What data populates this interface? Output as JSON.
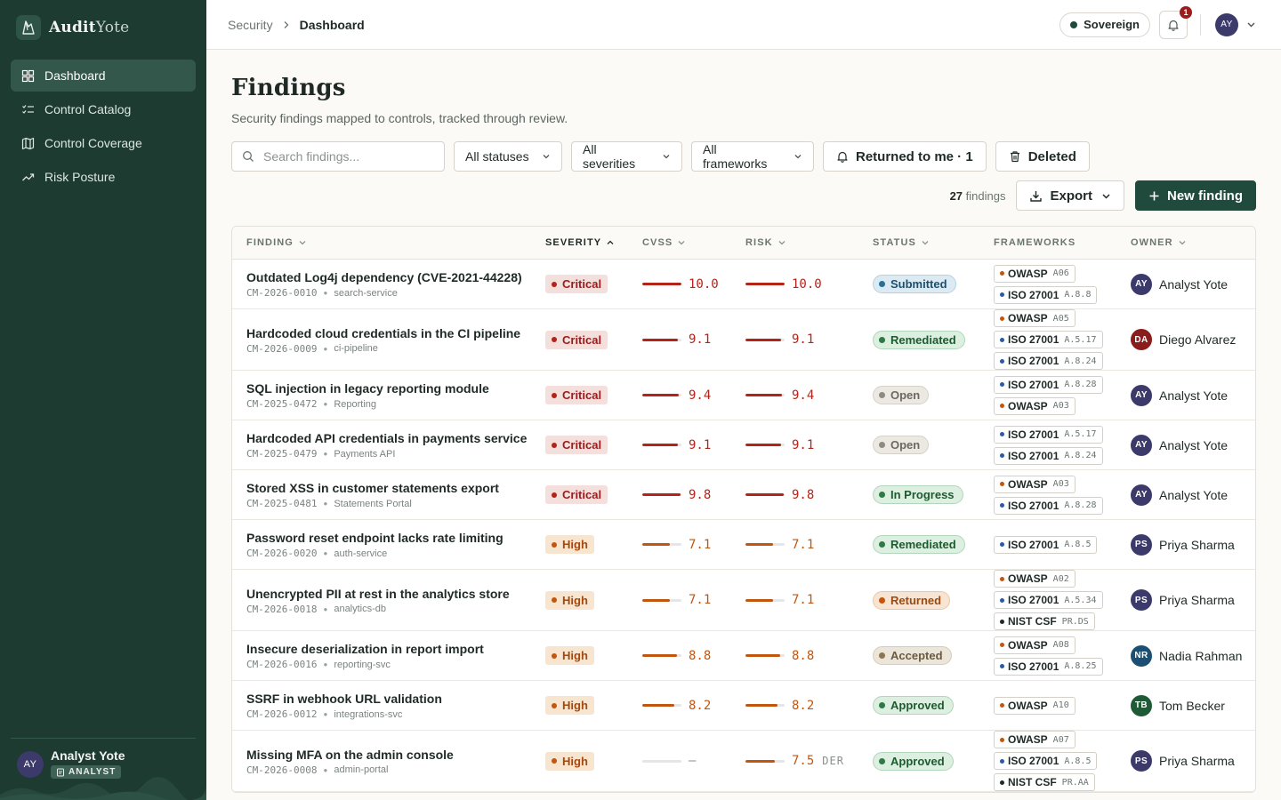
{
  "app": {
    "brand_bold": "Audit",
    "brand_thin": "Yote"
  },
  "sidebar": {
    "items": [
      {
        "label": "Dashboard",
        "icon": "dashboard-icon",
        "active": true
      },
      {
        "label": "Control Catalog",
        "icon": "checklist-icon",
        "active": false
      },
      {
        "label": "Control Coverage",
        "icon": "map-icon",
        "active": false
      },
      {
        "label": "Risk Posture",
        "icon": "trend-icon",
        "active": false
      }
    ],
    "user": {
      "initials": "AY",
      "name": "Analyst Yote",
      "role": "ANALYST"
    }
  },
  "topbar": {
    "breadcrumb": [
      "Security",
      "Dashboard"
    ],
    "environment": "Sovereign",
    "notifications": "1",
    "user_initials": "AY"
  },
  "page": {
    "title": "Findings",
    "subtitle": "Security findings mapped to controls, tracked through review."
  },
  "filters": {
    "search_placeholder": "Search findings...",
    "status": "All statuses",
    "severity": "All severities",
    "framework": "All frameworks",
    "returned": "Returned to me · 1",
    "deleted": "Deleted"
  },
  "toolbar": {
    "count": "27",
    "count_label": "findings",
    "export": "Export",
    "new": "New finding"
  },
  "table": {
    "columns": [
      "FINDING",
      "SEVERITY",
      "CVSS",
      "RISK",
      "STATUS",
      "FRAMEWORKS",
      "OWNER"
    ],
    "sorted_column": "SEVERITY",
    "rows": [
      {
        "title": "Outdated Log4j dependency (CVE-2021-44228)",
        "id": "CM-2026-0010",
        "asset": "search-service",
        "severity": "Critical",
        "cvss": "10.0",
        "cvss_pct": 1.0,
        "risk": "10.0",
        "risk_pct": 1.0,
        "risk_tag": "",
        "status": "Submitted",
        "frameworks": [
          {
            "name": "OWASP",
            "code": "A06"
          },
          {
            "name": "ISO 27001",
            "code": "A.8.8"
          }
        ],
        "owner": {
          "initials": "AY",
          "name": "Analyst Yote"
        }
      },
      {
        "title": "Hardcoded cloud credentials in the CI pipeline",
        "id": "CM-2026-0009",
        "asset": "ci-pipeline",
        "severity": "Critical",
        "cvss": "9.1",
        "cvss_pct": 0.91,
        "risk": "9.1",
        "risk_pct": 0.91,
        "risk_tag": "",
        "status": "Remediated",
        "frameworks": [
          {
            "name": "OWASP",
            "code": "A05"
          },
          {
            "name": "ISO 27001",
            "code": "A.5.17"
          },
          {
            "name": "ISO 27001",
            "code": "A.8.24"
          }
        ],
        "owner": {
          "initials": "DA",
          "name": "Diego Alvarez"
        }
      },
      {
        "title": "SQL injection in legacy reporting module",
        "id": "CM-2025-0472",
        "asset": "Reporting",
        "severity": "Critical",
        "cvss": "9.4",
        "cvss_pct": 0.94,
        "risk": "9.4",
        "risk_pct": 0.94,
        "risk_tag": "",
        "status": "Open",
        "frameworks": [
          {
            "name": "ISO 27001",
            "code": "A.8.28"
          },
          {
            "name": "OWASP",
            "code": "A03"
          }
        ],
        "owner": {
          "initials": "AY",
          "name": "Analyst Yote"
        }
      },
      {
        "title": "Hardcoded API credentials in payments service",
        "id": "CM-2025-0479",
        "asset": "Payments API",
        "severity": "Critical",
        "cvss": "9.1",
        "cvss_pct": 0.91,
        "risk": "9.1",
        "risk_pct": 0.91,
        "risk_tag": "",
        "status": "Open",
        "frameworks": [
          {
            "name": "ISO 27001",
            "code": "A.5.17"
          },
          {
            "name": "ISO 27001",
            "code": "A.8.24"
          }
        ],
        "owner": {
          "initials": "AY",
          "name": "Analyst Yote"
        }
      },
      {
        "title": "Stored XSS in customer statements export",
        "id": "CM-2025-0481",
        "asset": "Statements Portal",
        "severity": "Critical",
        "cvss": "9.8",
        "cvss_pct": 0.98,
        "risk": "9.8",
        "risk_pct": 0.98,
        "risk_tag": "",
        "status": "In Progress",
        "frameworks": [
          {
            "name": "OWASP",
            "code": "A03"
          },
          {
            "name": "ISO 27001",
            "code": "A.8.28"
          }
        ],
        "owner": {
          "initials": "AY",
          "name": "Analyst Yote"
        }
      },
      {
        "title": "Password reset endpoint lacks rate limiting",
        "id": "CM-2026-0020",
        "asset": "auth-service",
        "severity": "High",
        "cvss": "7.1",
        "cvss_pct": 0.71,
        "risk": "7.1",
        "risk_pct": 0.71,
        "risk_tag": "",
        "status": "Remediated",
        "frameworks": [
          {
            "name": "ISO 27001",
            "code": "A.8.5"
          }
        ],
        "owner": {
          "initials": "PS",
          "name": "Priya Sharma"
        }
      },
      {
        "title": "Unencrypted PII at rest in the analytics store",
        "id": "CM-2026-0018",
        "asset": "analytics-db",
        "severity": "High",
        "cvss": "7.1",
        "cvss_pct": 0.71,
        "risk": "7.1",
        "risk_pct": 0.71,
        "risk_tag": "",
        "status": "Returned",
        "frameworks": [
          {
            "name": "OWASP",
            "code": "A02"
          },
          {
            "name": "ISO 27001",
            "code": "A.5.34"
          },
          {
            "name": "NIST CSF",
            "code": "PR.DS"
          }
        ],
        "owner": {
          "initials": "PS",
          "name": "Priya Sharma"
        }
      },
      {
        "title": "Insecure deserialization in report import",
        "id": "CM-2026-0016",
        "asset": "reporting-svc",
        "severity": "High",
        "cvss": "8.8",
        "cvss_pct": 0.88,
        "risk": "8.8",
        "risk_pct": 0.88,
        "risk_tag": "",
        "status": "Accepted",
        "frameworks": [
          {
            "name": "OWASP",
            "code": "A08"
          },
          {
            "name": "ISO 27001",
            "code": "A.8.25"
          }
        ],
        "owner": {
          "initials": "NR",
          "name": "Nadia Rahman"
        }
      },
      {
        "title": "SSRF in webhook URL validation",
        "id": "CM-2026-0012",
        "asset": "integrations-svc",
        "severity": "High",
        "cvss": "8.2",
        "cvss_pct": 0.82,
        "risk": "8.2",
        "risk_pct": 0.82,
        "risk_tag": "",
        "status": "Approved",
        "frameworks": [
          {
            "name": "OWASP",
            "code": "A10"
          }
        ],
        "owner": {
          "initials": "TB",
          "name": "Tom Becker"
        }
      },
      {
        "title": "Missing MFA on the admin console",
        "id": "CM-2026-0008",
        "asset": "admin-portal",
        "severity": "High",
        "cvss": "—",
        "cvss_pct": 0,
        "risk": "7.5",
        "risk_pct": 0.75,
        "risk_tag": "DER",
        "status": "Approved",
        "frameworks": [
          {
            "name": "OWASP",
            "code": "A07"
          },
          {
            "name": "ISO 27001",
            "code": "A.8.5"
          },
          {
            "name": "NIST CSF",
            "code": "PR.AA"
          }
        ],
        "owner": {
          "initials": "PS",
          "name": "Priya Sharma"
        }
      }
    ]
  },
  "colors": {
    "sidebar": "#1e3b32",
    "primary": "#1f4a3c",
    "critical": "#b42318",
    "high": "#c2560f",
    "framework_dots": {
      "OWASP": "#c2560f",
      "ISO 27001": "#2b5aa3",
      "NIST CSF": "#1f2a26"
    },
    "status": {
      "Submitted": {
        "bg": "#dcebf3",
        "border": "#b4d2e3",
        "fg": "#1c4f6e",
        "dot": "#2a6f96"
      },
      "Remediated": {
        "bg": "#dcefe0",
        "border": "#b1d6b9",
        "fg": "#1e5a2f",
        "dot": "#2f7a44"
      },
      "Open": {
        "bg": "#ece9e3",
        "border": "#d5d1c8",
        "fg": "#6b6860",
        "dot": "#8f8b82"
      },
      "In Progress": {
        "bg": "#dcefe0",
        "border": "#b1d6b9",
        "fg": "#1e5a2f",
        "dot": "#2f7a44"
      },
      "Returned": {
        "bg": "#f8e4d2",
        "border": "#ecc6a3",
        "fg": "#9a4a12",
        "dot": "#c2560f"
      },
      "Accepted": {
        "bg": "#ece5d9",
        "border": "#d8ccb8",
        "fg": "#6b5a3e",
        "dot": "#8c7552"
      },
      "Approved": {
        "bg": "#dcefe0",
        "border": "#b1d6b9",
        "fg": "#1e5a2f",
        "dot": "#2f7a44"
      }
    },
    "owners": {
      "AY": "#3b3a6a",
      "DA": "#8a1c1c",
      "PS": "#3b3a6a",
      "NR": "#1d4f73",
      "TB": "#1f5a36"
    }
  }
}
